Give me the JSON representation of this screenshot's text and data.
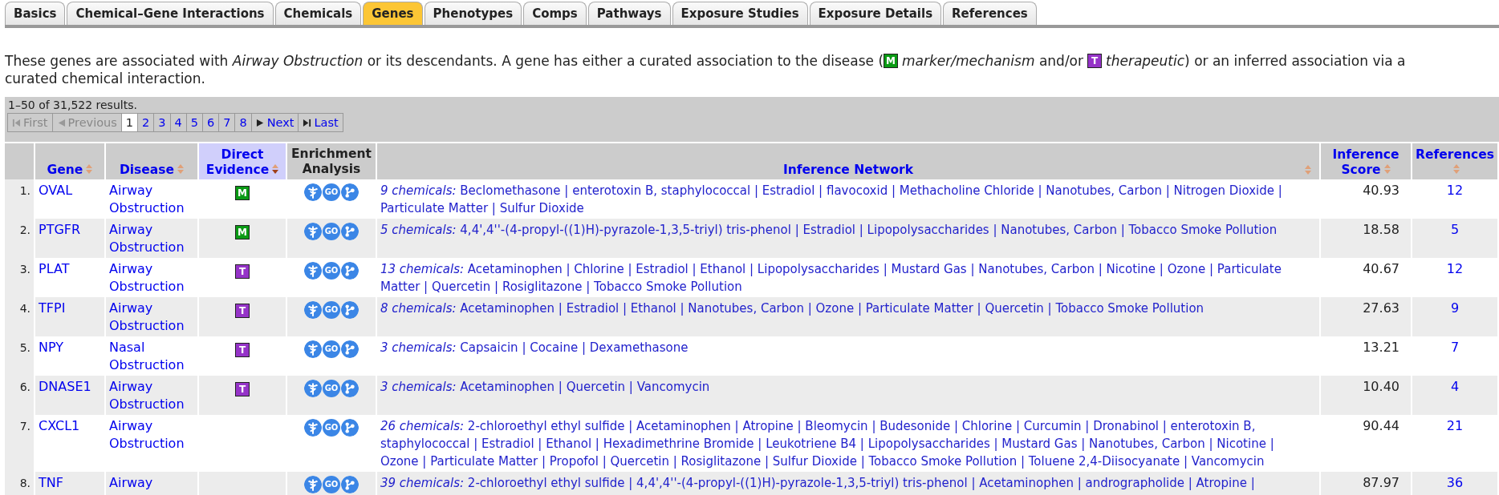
{
  "tabs": [
    {
      "label": "Basics",
      "selected": false
    },
    {
      "label": "Chemical–Gene Interactions",
      "selected": false
    },
    {
      "label": "Chemicals",
      "selected": false
    },
    {
      "label": "Genes",
      "selected": true
    },
    {
      "label": "Phenotypes",
      "selected": false
    },
    {
      "label": "Comps",
      "selected": false
    },
    {
      "label": "Pathways",
      "selected": false
    },
    {
      "label": "Exposure Studies",
      "selected": false
    },
    {
      "label": "Exposure Details",
      "selected": false
    },
    {
      "label": "References",
      "selected": false
    }
  ],
  "intro": [
    {
      "kind": "text",
      "text": "These genes are associated with *Airway Obstruction* or its descendants. A gene has either a curated association to the disease ("
    },
    {
      "kind": "marker",
      "label": "M"
    },
    {
      "kind": "text",
      "text": "*marker/mechanism* and/or"
    },
    {
      "kind": "therapeutic",
      "label": "T"
    },
    {
      "kind": "text",
      "text": "*therapeutic*) or an inferred association via a"
    }
  ],
  "intro_line2": "curated chemical interaction.",
  "results": "1–50 of 31,522 results.",
  "pager": [
    {
      "kind": "first",
      "label": "First",
      "disabled": true,
      "selected": false
    },
    {
      "kind": "prev",
      "label": "Previous",
      "disabled": true,
      "selected": false
    },
    {
      "kind": "page",
      "label": "1",
      "disabled": false,
      "selected": true
    },
    {
      "kind": "page",
      "label": "2",
      "disabled": false,
      "selected": false
    },
    {
      "kind": "page",
      "label": "3",
      "disabled": false,
      "selected": false
    },
    {
      "kind": "page",
      "label": "4",
      "disabled": false,
      "selected": false
    },
    {
      "kind": "page",
      "label": "5",
      "disabled": false,
      "selected": false
    },
    {
      "kind": "page",
      "label": "6",
      "disabled": false,
      "selected": false
    },
    {
      "kind": "page",
      "label": "7",
      "disabled": false,
      "selected": false
    },
    {
      "kind": "page",
      "label": "8",
      "disabled": false,
      "selected": false
    },
    {
      "kind": "next",
      "label": "Next",
      "disabled": false,
      "selected": false
    },
    {
      "kind": "last",
      "label": "Last",
      "disabled": false,
      "selected": false
    }
  ],
  "columns": [
    {
      "label": "Gene",
      "sortable": true,
      "selected": false
    },
    {
      "label": "Disease",
      "sortable": true,
      "selected": false
    },
    {
      "label": "Direct Evidence",
      "sortable": true,
      "selected": true
    },
    {
      "label": "Enrichment Analysis",
      "sortable": false,
      "selected": false
    },
    {
      "label": "Inference Network",
      "sortable": true,
      "selected": false
    },
    {
      "label": "Inference Score",
      "sortable": true,
      "selected": false
    },
    {
      "label": "References",
      "sortable": true,
      "selected": false
    }
  ],
  "rows": [
    {
      "num": "1.",
      "gene": "OVAL",
      "disease": "Airway Obstruction",
      "evidence": {
        "label": "M",
        "kind": "marker"
      },
      "go": "GO",
      "network": "*9 chemicals:* Beclomethasone | enterotoxin B, staphylococcal | Estradiol | flavocoxid | Methacholine Chloride | Nanotubes, Carbon | Nitrogen Dioxide | Particulate Matter | Sulfur Dioxide",
      "score": "40.93",
      "references": "12"
    },
    {
      "num": "2.",
      "gene": "PTGFR",
      "disease": "Airway Obstruction",
      "evidence": {
        "label": "M",
        "kind": "marker"
      },
      "go": "GO",
      "network": "*5 chemicals:* 4,4',4''-(4-propyl-((1)H)-pyrazole-1,3,5-triyl) tris-phenol | Estradiol | Lipopolysaccharides | Nanotubes, Carbon | Tobacco Smoke Pollution",
      "score": "18.58",
      "references": "5"
    },
    {
      "num": "3.",
      "gene": "PLAT",
      "disease": "Airway Obstruction",
      "evidence": {
        "label": "T",
        "kind": "therapeutic"
      },
      "go": "GO",
      "network": "*13 chemicals:* Acetaminophen | Chlorine | Estradiol | Ethanol | Lipopolysaccharides | Mustard Gas | Nanotubes, Carbon | Nicotine | Ozone | Particulate Matter | Quercetin | Rosiglitazone | Tobacco Smoke Pollution",
      "score": "40.67",
      "references": "12"
    },
    {
      "num": "4.",
      "gene": "TFPI",
      "disease": "Airway Obstruction",
      "evidence": {
        "label": "T",
        "kind": "therapeutic"
      },
      "go": "GO",
      "network": "*8 chemicals:* Acetaminophen | Estradiol | Ethanol | Nanotubes, Carbon | Ozone | Particulate Matter | Quercetin | Tobacco Smoke Pollution",
      "score": "27.63",
      "references": "9"
    },
    {
      "num": "5.",
      "gene": "NPY",
      "disease": "Nasal Obstruction",
      "evidence": {
        "label": "T",
        "kind": "therapeutic"
      },
      "go": "GO",
      "network": "*3 chemicals:* Capsaicin | Cocaine | Dexamethasone",
      "score": "13.21",
      "references": "7"
    },
    {
      "num": "6.",
      "gene": "DNASE1",
      "disease": "Airway Obstruction",
      "evidence": {
        "label": "T",
        "kind": "therapeutic"
      },
      "go": "GO",
      "network": "*3 chemicals:* Acetaminophen | Quercetin | Vancomycin",
      "score": "10.40",
      "references": "4"
    },
    {
      "num": "7.",
      "gene": "CXCL1",
      "disease": "Airway Obstruction",
      "go": "GO",
      "network": "*26 chemicals:* 2-chloroethyl ethyl sulfide | Acetaminophen | Atropine | Bleomycin | Budesonide | Chlorine | Curcumin | Dronabinol | enterotoxin B, staphylococcal | Estradiol | Ethanol | Hexadimethrine Bromide | Leukotriene B4 | Lipopolysaccharides | Mustard Gas | Nanotubes, Carbon | Nicotine | Ozone | Particulate Matter | Propofol | Quercetin | Rosiglitazone | Sulfur Dioxide | Tobacco Smoke Pollution | Toluene 2,4-Diisocyanate | Vancomycin",
      "score": "90.44",
      "references": "21"
    },
    {
      "num": "8.",
      "gene": "TNF",
      "disease": "Airway",
      "go": "GO",
      "network": "*39 chemicals:* 2-chloroethyl ethyl sulfide | 4,4',4''-(4-propyl-((1)H)-pyrazole-1,3,5-triyl) tris-phenol | Acetaminophen | andrographolide | Atropine |",
      "score": "87.97",
      "references": "36"
    }
  ]
}
